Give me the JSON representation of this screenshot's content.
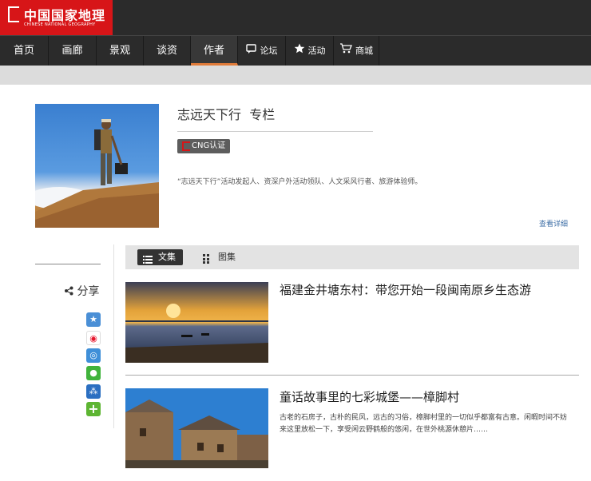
{
  "header": {
    "logo_cn": "中国国家地理",
    "logo_en": "CHINESE NATIONAL GEOGRAPHY"
  },
  "nav": {
    "items": [
      {
        "label": "首页"
      },
      {
        "label": "画廊"
      },
      {
        "label": "景观"
      },
      {
        "label": "谈资"
      },
      {
        "label": "作者",
        "active": true
      },
      {
        "label": "论坛",
        "icon": "speech-bubble-icon"
      },
      {
        "label": "活动",
        "icon": "star-icon"
      },
      {
        "label": "商城",
        "icon": "shopping-cart-icon"
      }
    ]
  },
  "profile": {
    "name": "志远天下行",
    "column_suffix": "专栏",
    "badge": "CNG认证",
    "description": "“志远天下行”活动发起人、资深户外活动领队、人文采风行者、旅游体验师。",
    "more_link": "查看详细"
  },
  "share": {
    "label": "分享",
    "icons": [
      "qzone-star-icon",
      "weibo-icon",
      "tencent-weibo-icon",
      "wechat-icon",
      "renren-icon",
      "more-plus-icon"
    ]
  },
  "tabs": {
    "articles": "文集",
    "gallery": "图集"
  },
  "articles": [
    {
      "title": "福建金井塘东村：带您开始一段闽南原乡生态游"
    },
    {
      "title": "童话故事里的七彩城堡——樟脚村",
      "summary": "古老的石房子，古朴的民风，远古的习俗，樟脚村里的一切似乎都富有古意。闲暇时间不妨来这里放松一下，享受闲云野鹤般的悠闲，在世外桃源休憩片……"
    }
  ],
  "colors": {
    "brand_red": "#d71518",
    "nav_bg": "#2b2b2b",
    "active_underline": "#e07b39",
    "link_blue": "#3d6ea6"
  }
}
